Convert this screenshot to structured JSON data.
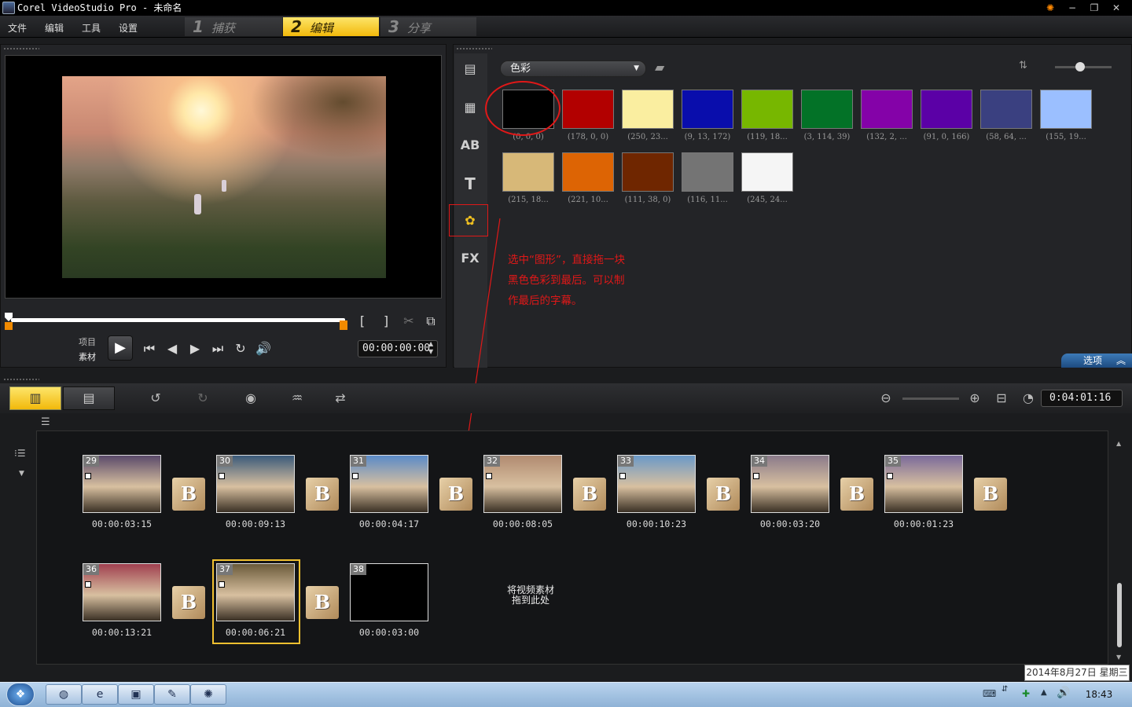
{
  "window": {
    "title": "Corel VideoStudio Pro - 未命名"
  },
  "menu": [
    "文件",
    "编辑",
    "工具",
    "设置"
  ],
  "steps": [
    {
      "num": "1",
      "label": "捕获"
    },
    {
      "num": "2",
      "label": "编辑"
    },
    {
      "num": "3",
      "label": "分享"
    }
  ],
  "preview": {
    "mode_project": "项目",
    "mode_clip": "素材",
    "bracket_in": "[",
    "bracket_out": "]",
    "timecode": "00:00:00:00"
  },
  "library": {
    "category": "色彩",
    "swatches": [
      {
        "color": "#000000",
        "label": "(0, 0, 0)"
      },
      {
        "color": "#b20000",
        "label": "(178, 0, 0)"
      },
      {
        "color": "#faeea0",
        "label": "(250, 23..."
      },
      {
        "color": "#090dac",
        "label": "(9, 13, 172)"
      },
      {
        "color": "#77b700",
        "label": "(119, 18..."
      },
      {
        "color": "#037227",
        "label": "(3, 114, 39)"
      },
      {
        "color": "#8402a8",
        "label": "(132, 2, ..."
      },
      {
        "color": "#5b00a6",
        "label": "(91, 0, 166)"
      },
      {
        "color": "#3a4080",
        "label": "(58, 64, ..."
      },
      {
        "color": "#9bbfff",
        "label": "(155, 19..."
      },
      {
        "color": "#d7b878",
        "label": "(215, 18..."
      },
      {
        "color": "#dd6404",
        "label": "(221, 10..."
      },
      {
        "color": "#6f2600",
        "label": "(111, 38, 0)"
      },
      {
        "color": "#747474",
        "label": "(116, 11..."
      },
      {
        "color": "#f5f5f5",
        "label": "(245, 24..."
      }
    ],
    "annotation": "选中“图形”，直接拖一块黑色色彩到最后。可以制作最后的字幕。",
    "options_label": "选项"
  },
  "timeline": {
    "timecode": "0:04:01:16",
    "row1": [
      {
        "num": "29",
        "time": "00:00:03:15",
        "tone": "#5a4a6a"
      },
      {
        "num": "30",
        "time": "00:00:09:13",
        "tone": "#3a5a7a"
      },
      {
        "num": "31",
        "time": "00:00:04:17",
        "tone": "#5a8ac8"
      },
      {
        "num": "32",
        "time": "00:00:08:05",
        "tone": "#b08a70"
      },
      {
        "num": "33",
        "time": "00:00:10:23",
        "tone": "#6a98c8"
      },
      {
        "num": "34",
        "time": "00:00:03:20",
        "tone": "#8a7a8a"
      },
      {
        "num": "35",
        "time": "00:00:01:23",
        "tone": "#7a6a9a"
      }
    ],
    "row2": [
      {
        "num": "36",
        "time": "00:00:13:21",
        "tone": "#a04050"
      },
      {
        "num": "37",
        "time": "00:00:06:21",
        "tone": "#6a5a3a"
      },
      {
        "num": "38",
        "time": "00:00:03:00",
        "tone": "#000000"
      }
    ],
    "transition_glyph": "B",
    "drop_hint": "将视频素材拖到此处"
  },
  "taskbar": {
    "clock": "18:43",
    "date": "2014年8月27日 星期三"
  }
}
